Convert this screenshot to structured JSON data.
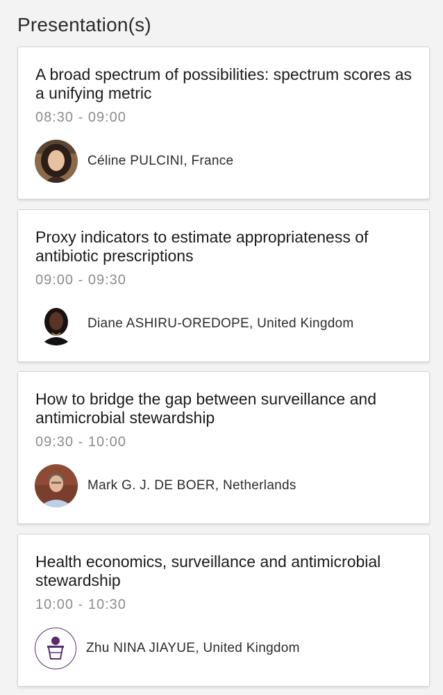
{
  "section": {
    "title": "Presentation(s)"
  },
  "presentations": [
    {
      "title": "A broad spectrum of possibilities: spectrum scores as a unifying metric",
      "time": "08:30 - 09:00",
      "speaker": "Céline PULCINI, France",
      "avatar_icon": "speaker-photo"
    },
    {
      "title": "Proxy indicators to estimate appropriateness of antibiotic prescriptions",
      "time": "09:00 - 09:30",
      "speaker": "Diane ASHIRU-OREDOPE, United Kingdom",
      "avatar_icon": "speaker-photo"
    },
    {
      "title": "How to bridge the gap between surveillance and antimicrobial stewardship",
      "time": "09:30 - 10:00",
      "speaker": "Mark G. J. DE BOER, Netherlands",
      "avatar_icon": "speaker-photo"
    },
    {
      "title": "Health economics, surveillance and antimicrobial stewardship",
      "time": "10:00 - 10:30",
      "speaker": "Zhu NINA JIAYUE, United Kingdom",
      "avatar_icon": "speaker-placeholder-icon"
    }
  ],
  "colors": {
    "placeholder_accent": "#5a2a6e",
    "time_text": "#8c8c8c"
  }
}
